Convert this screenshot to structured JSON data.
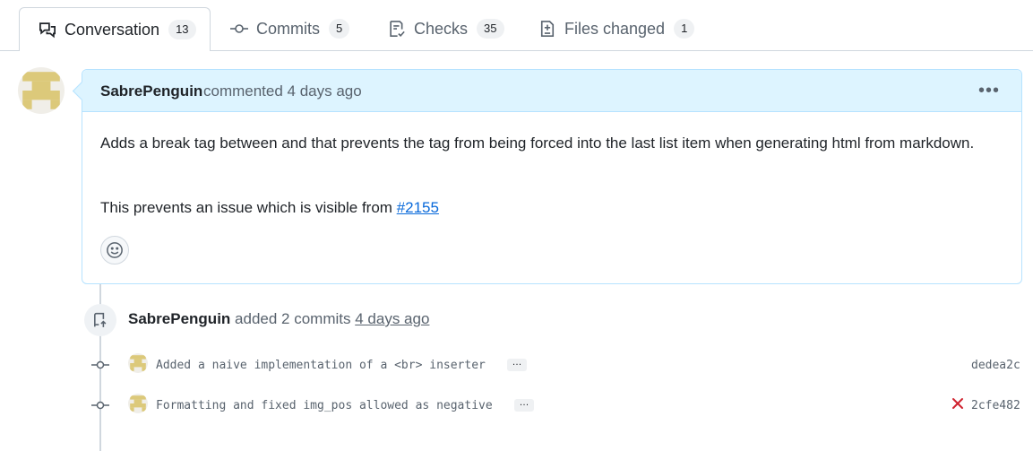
{
  "tabs": [
    {
      "label": "Conversation",
      "count": "13",
      "icon": "comment-discussion-icon"
    },
    {
      "label": "Commits",
      "count": "5",
      "icon": "git-commit-icon"
    },
    {
      "label": "Checks",
      "count": "35",
      "icon": "checklist-icon"
    },
    {
      "label": "Files changed",
      "count": "1",
      "icon": "file-diff-icon"
    }
  ],
  "comment": {
    "author": "SabrePenguin",
    "meta": "commented 4 days ago",
    "paragraph1": "Adds a break tag between and  that prevents the  tag from being forced into the last list item when generating html from markdown.",
    "paragraph2_prefix": "This prevents an issue which is visible from ",
    "paragraph2_link": "#2155"
  },
  "event": {
    "author": "SabrePenguin",
    "action": "added 2 commits",
    "time": "4 days ago"
  },
  "commits": [
    {
      "message": "Added a naive implementation of a <br> inserter",
      "sha": "dedea2c",
      "status": "none"
    },
    {
      "message": "Formatting and fixed img_pos allowed as negative",
      "sha": "2cfe482",
      "status": "failed"
    }
  ],
  "colors": {
    "accent": "#0969da",
    "header_bg": "#ddf4ff",
    "fail": "#cf222e",
    "avatar": "#dcc97a"
  }
}
